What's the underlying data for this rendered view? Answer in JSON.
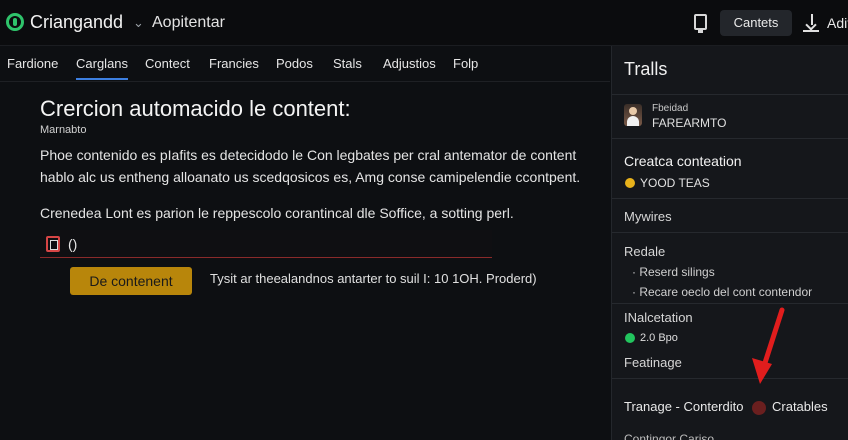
{
  "header": {
    "app_title": "Criangandd",
    "app_subtitle": "Aopitentar",
    "contents_label": "Cantets",
    "add_label": "Adit"
  },
  "tabs": [
    {
      "label": "Fardione"
    },
    {
      "label": "Carglans",
      "active": true
    },
    {
      "label": "Contect"
    },
    {
      "label": "Francies"
    },
    {
      "label": "Podos"
    },
    {
      "label": "Stals"
    },
    {
      "label": "Adjustios"
    },
    {
      "label": "Folp"
    }
  ],
  "main": {
    "title": "Crercion automacido le content:",
    "caption": "Marnabto",
    "paragraph_lines": [
      "Phoe contenido es  pIafits es detecidodo le Con legbates per cral antemator de content",
      "hablo alc us entheng alloanato us scedqosicos es, Amg conse camipelendie ccontpent."
    ],
    "instruction": "Crenedea Lont es parion le reppescolo corantincal dle Soffice, a sotting perl.",
    "input_value": "()",
    "generate_button": "De contenent",
    "status_text": "Tysit ar theealandnos antarter to suil I: 10 1OH. Proderd)"
  },
  "sidebar": {
    "title": "Tralls",
    "user_role": "Fbeidad",
    "user_name": "FAREARMTO",
    "section_title": "Creatca conteation",
    "section_subtitle": "YOOD TEAS",
    "mywires_label": "Mywires",
    "redale_label": "Redale",
    "redale_items": [
      "Reserd silings",
      "Recare oeclo del cont contendor"
    ],
    "status_label": "INalcetation",
    "status_value": "2.0 Bpo",
    "featinage_label": "Featinage",
    "template_label": "Tranage - Conterdito",
    "cratables_label": "Cratables",
    "cut_off_label": "Contingor Cariso",
    "colors": {
      "accent_yellow": "#e8b21b",
      "status_green": "#22c55e",
      "arrow_red": "#e11d1d"
    }
  }
}
